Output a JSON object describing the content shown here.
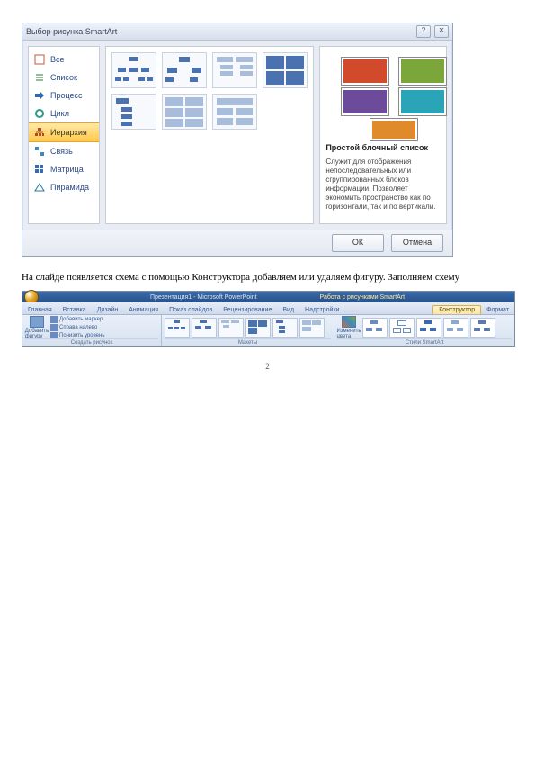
{
  "dialog": {
    "title": "Выбор рисунка SmartArt",
    "window_buttons": {
      "help": "?",
      "close": "✕"
    },
    "categories": [
      {
        "label": "Все"
      },
      {
        "label": "Список"
      },
      {
        "label": "Процесс"
      },
      {
        "label": "Цикл"
      },
      {
        "label": "Иерархия",
        "active": true
      },
      {
        "label": "Связь"
      },
      {
        "label": "Матрица"
      },
      {
        "label": "Пирамида"
      }
    ],
    "preview": {
      "title": "Простой блочный список",
      "desc": "Служит для отображения непоследовательных или сгруппированных блоков информации. Позволяет экономить пространство как по горизонтали, так и по вертикали."
    },
    "buttons": {
      "ok": "ОК",
      "cancel": "Отмена"
    }
  },
  "caption": "На слайде появляется схема с помощью Конструктора добавляем или удаляем фигуру. Заполняем схему",
  "ribbon": {
    "app_title": "Презентация1 - Microsoft PowerPoint",
    "context_title": "Работа с рисунками SmartArt",
    "tabs": [
      "Главная",
      "Вставка",
      "Дизайн",
      "Анимация",
      "Показ слайдов",
      "Рецензирование",
      "Вид",
      "Надстройки"
    ],
    "context_tabs": [
      "Конструктор",
      "Формат"
    ],
    "groups": {
      "g1": {
        "label": "Создать рисунок",
        "big": "Добавить фигуру",
        "lines": [
          "Добавить маркер",
          "Справа налево",
          "Понизить уровень"
        ]
      },
      "g2": {
        "label": "Макеты"
      },
      "g3": {
        "label": "Стили SmartArt",
        "big": "Изменить цвета"
      }
    }
  },
  "page_number": "2"
}
